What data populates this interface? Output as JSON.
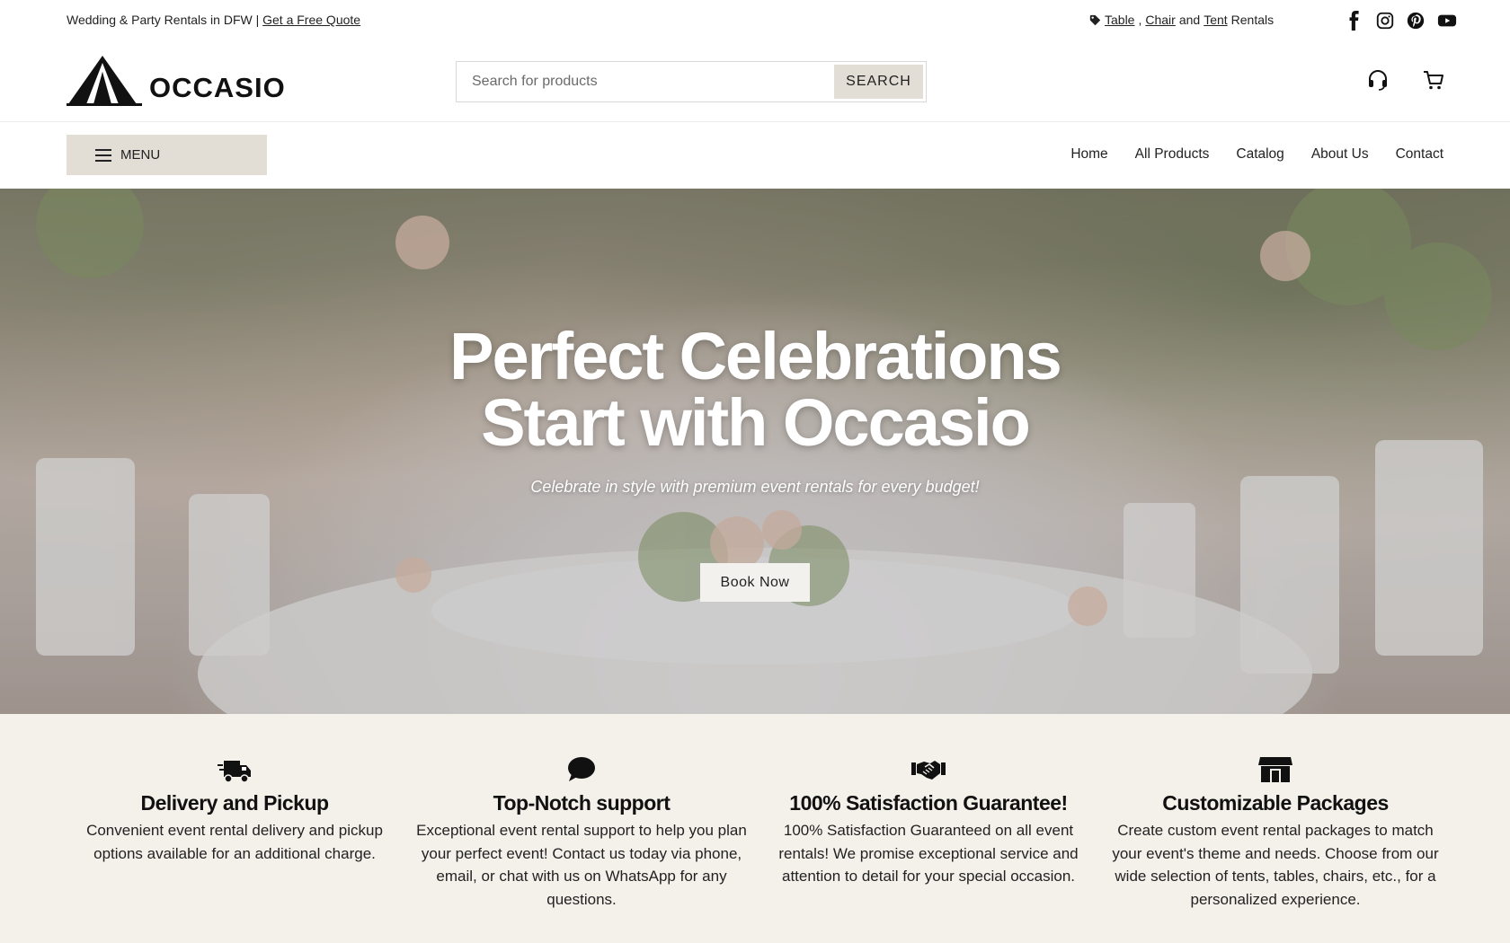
{
  "topbar": {
    "tagline": "Wedding & Party Rentals in DFW |",
    "quote_link": "Get a Free Quote",
    "promo": {
      "link1": "Table",
      "sep1": ",",
      "link2": "Chair",
      "and": "and",
      "link3": "Tent",
      "suffix": "Rentals"
    },
    "socials": [
      "facebook-icon",
      "instagram-icon",
      "pinterest-icon",
      "youtube-icon"
    ]
  },
  "header": {
    "logo_text": "OCCASIO",
    "search_placeholder": "Search for products",
    "search_button": "SEARCH",
    "icons": [
      "headset-icon",
      "cart-icon"
    ]
  },
  "nav": {
    "menu_label": "MENU",
    "links": [
      "Home",
      "All Products",
      "Catalog",
      "About Us",
      "Contact"
    ]
  },
  "hero": {
    "title_line1": "Perfect Celebrations",
    "title_line2": "Start with Occasio",
    "subtitle": "Celebrate in style with premium event rentals for every budget!",
    "button": "Book Now"
  },
  "features": [
    {
      "icon": "truck-icon",
      "title": "Delivery and Pickup",
      "text": "Convenient event rental delivery and pickup options available for an additional charge."
    },
    {
      "icon": "chat-bubble-icon",
      "title": "Top-Notch support",
      "text": "Exceptional event rental support to help you plan your perfect event! Contact us today via phone, email, or chat with us on WhatsApp for any questions."
    },
    {
      "icon": "handshake-icon",
      "title": "100% Satisfaction Guarantee!",
      "text": "100% Satisfaction Guaranteed on all event rentals! We promise exceptional service and attention to detail for your special occasion."
    },
    {
      "icon": "store-icon",
      "title": "Customizable Packages",
      "text": "Create custom event rental packages to match your event's theme and needs. Choose from our wide selection of tents, tables, chairs, etc., for a personalized experience."
    }
  ],
  "colors": {
    "accent_beige": "#e2ddd5",
    "features_bg": "#f4f1eb",
    "text": "#1b1b1b"
  }
}
